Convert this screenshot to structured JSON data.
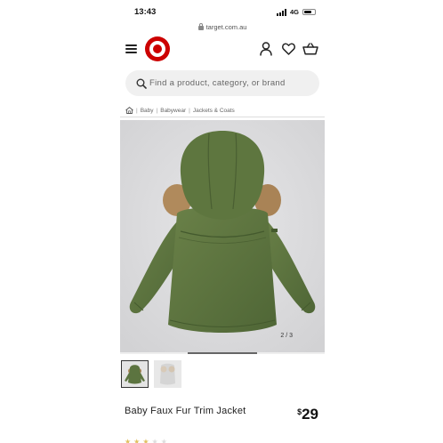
{
  "status_bar": {
    "time": "13:43",
    "network": "4G"
  },
  "url_bar": {
    "url": "target.com.au"
  },
  "header": {
    "logo": "target-logo",
    "icons": [
      "menu-icon",
      "account-icon",
      "heart-icon",
      "basket-icon"
    ]
  },
  "search": {
    "placeholder": "Find a product, category, or brand"
  },
  "breadcrumb": {
    "items": [
      "Baby",
      "Babywear",
      "Jackets & Coats"
    ]
  },
  "gallery": {
    "counter": "2 / 3",
    "current_slide": 2,
    "total_slides": 3
  },
  "product": {
    "name": "Baby Faux Fur Trim Jacket",
    "price_symbol": "$",
    "price_value": "29"
  },
  "colors": {
    "brand_red": "#cc0000",
    "jacket_green": "#5c7440",
    "fur_tan": "#b08a5c"
  }
}
